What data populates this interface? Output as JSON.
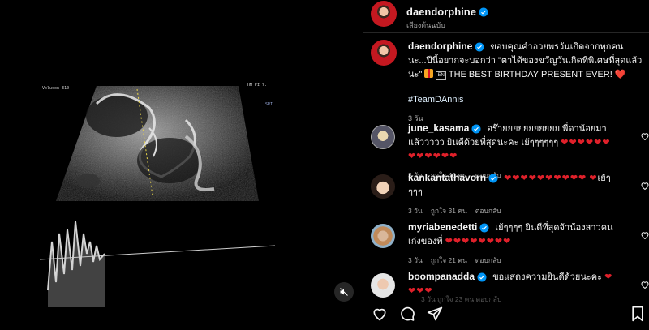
{
  "post": {
    "author": "daendorphine",
    "original_audio": "เสียงต้นฉบับ",
    "caption_text_1": "ขอบคุณคำอวยพรวันเกิดจากทุกคนนะ...ปีนี้อยากจะบอกว่า \"ตาได้ของขวัญวันเกิดที่พิเศษที่สุดแล้วนะ\"",
    "caption_en_box": "EN",
    "caption_text_2": "THE BEST BIRTHDAY PRESENT EVER!",
    "caption_heart": "❤️",
    "hashtag": "#TeamDAnnis",
    "time": "3 วัน"
  },
  "scan": {
    "label_left": "Voluson E10",
    "label_right": "HM PI 7.",
    "label_side": "SRI"
  },
  "comments": [
    {
      "username": "june_kasama",
      "text": "อร๊ายยยยยยยยยยย พี่ดาน้อยมาแล้ววววว ยินดีด้วยที่สุดนะคะ เย้ๆๆๆๆๆๆ",
      "hearts": "❤❤❤❤❤❤❤❤❤❤❤❤",
      "time": "3 วัน",
      "likes": "ถูกใจ 40 คน",
      "reply": "ตอบกลับ"
    },
    {
      "username": "kankantathavorn",
      "text": "",
      "hearts_before": "❤❤❤❤❤❤❤❤❤❤",
      "hearts": "❤",
      "text_after": "เย้ๆๆๆๆ",
      "time": "3 วัน",
      "likes": "ถูกใจ 31 คน",
      "reply": "ตอบกลับ"
    },
    {
      "username": "myriabenedetti",
      "text": "เย้ๆๆๆๆ ยินดีที่สุดจ้าน้องสาวคนเก่งของพี่",
      "hearts": "❤❤❤❤❤❤❤❤",
      "time": "3 วัน",
      "likes": "ถูกใจ 21 คน",
      "reply": "ตอบกลับ"
    },
    {
      "username": "boompanadda",
      "text": "ขอแสดงความยินดีด้วยนะคะ",
      "hearts": "❤❤❤❤"
    }
  ],
  "faded_meta": "3 วัน   ถูกใจ 23 คน   ตอบกลับ",
  "actions": {
    "like": "heart-outline-icon",
    "comment": "comment-icon",
    "share": "share-icon",
    "save": "bookmark-icon"
  },
  "colors": {
    "background": "#000000",
    "text": "#f5f5f5",
    "muted": "#a8a8a8",
    "verified": "#0095f6",
    "heart": "#e0202a",
    "hashtag": "#e0f1ff"
  }
}
